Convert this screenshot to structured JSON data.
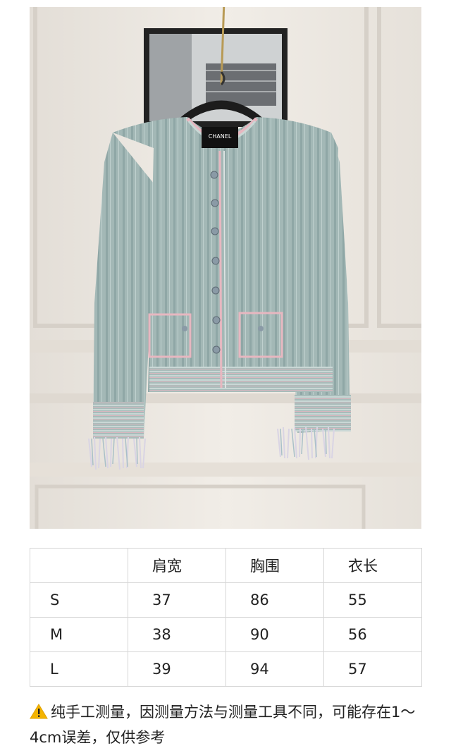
{
  "photo": {
    "label_text": "CHANEL"
  },
  "size_table": {
    "headers": [
      "",
      "肩宽",
      "胸围",
      "衣长"
    ],
    "rows": [
      [
        "S",
        "37",
        "86",
        "55"
      ],
      [
        "M",
        "38",
        "90",
        "56"
      ],
      [
        "L",
        "39",
        "94",
        "57"
      ]
    ]
  },
  "note": {
    "icon": "warning-icon",
    "text": "纯手工测量，因测量方法与测量工具不同，可能存在1～4cm误差，仅供参考"
  },
  "colors": {
    "cardigan": "#9fb5b3",
    "trim": "#e7b7c0",
    "wall": "#ece8e1",
    "warning": "#f4b400"
  }
}
